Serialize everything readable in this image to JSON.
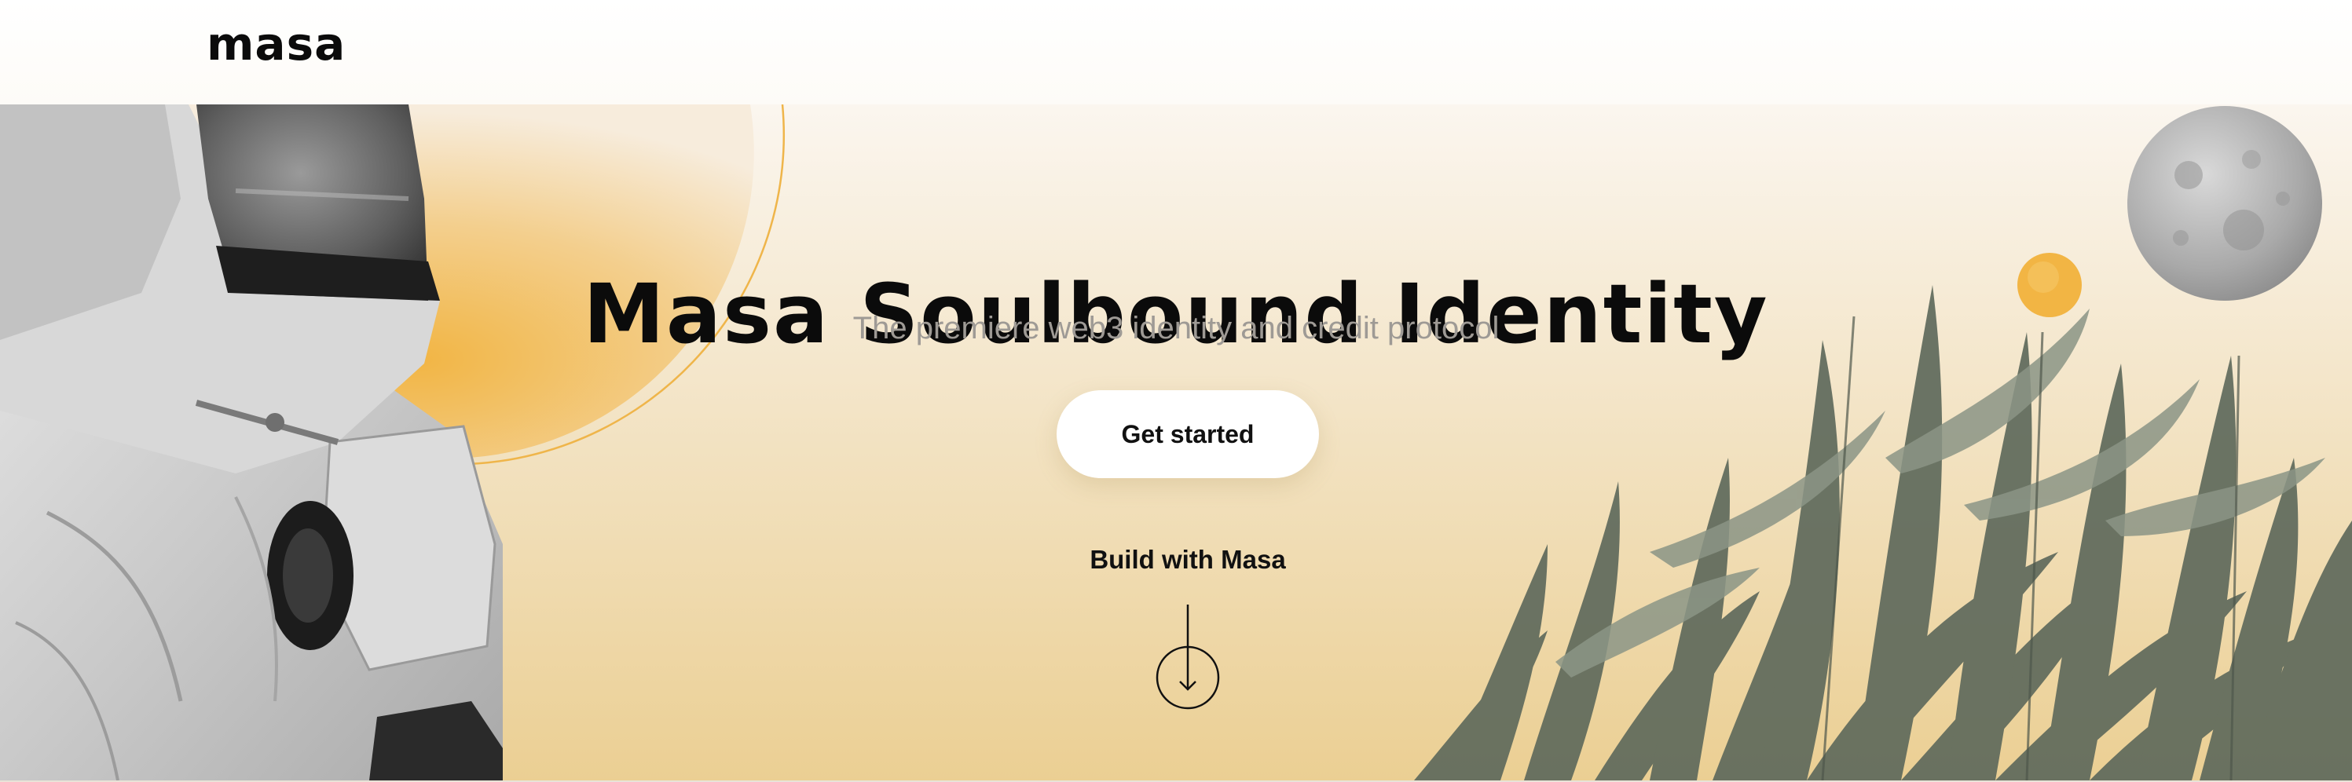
{
  "header": {
    "logo_text": "masa"
  },
  "hero": {
    "title": "Masa Soulbound Identity",
    "subtitle": "The premiere web3 identity and credit protocol",
    "cta_label": "Get started",
    "build_label": "Build with Masa",
    "scroll_icon": "arrow-down-circle-icon"
  },
  "colors": {
    "accent_sun": "#f2b544",
    "text_dark": "#0b0b0b",
    "subtitle_grey": "#9e9a95",
    "bg_warm": "#ebcf93"
  }
}
